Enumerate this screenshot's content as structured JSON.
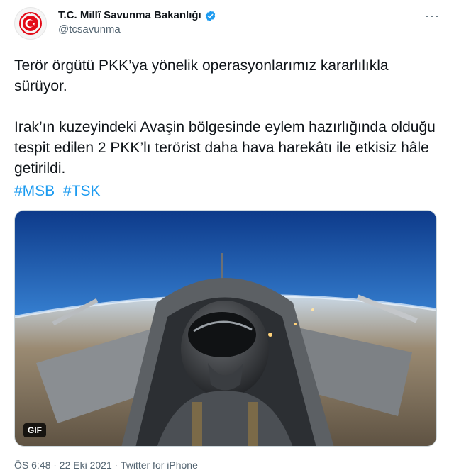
{
  "author": {
    "display_name": "T.C. Millî Savunma Bakanlığı",
    "handle": "@tcsavunma",
    "verified_icon": "verified-badge-icon",
    "avatar_icon": "ministry-emblem-icon"
  },
  "menu": {
    "more_label": "···"
  },
  "tweet": {
    "text": "Terör örgütü PKK’ya yönelik operasyonlarımız kararlılıkla sürüyor.\n\nIrak’ın kuzeyindeki Avaşin bölgesinde eylem hazırlığında olduğu tespit edilen 2 PKK’lı terörist daha hava harekâtı ile etkisiz hâle getirildi.",
    "hashtags": [
      "#MSB",
      "#TSK"
    ]
  },
  "media": {
    "badge": "GIF"
  },
  "meta": {
    "timestamp": "ÖS 6:48 · 22 Eki 2021 · Twitter for iPhone"
  },
  "colors": {
    "link": "#1d9bf0",
    "verified": "#1d9bf0",
    "emblem": "#e30a17"
  }
}
